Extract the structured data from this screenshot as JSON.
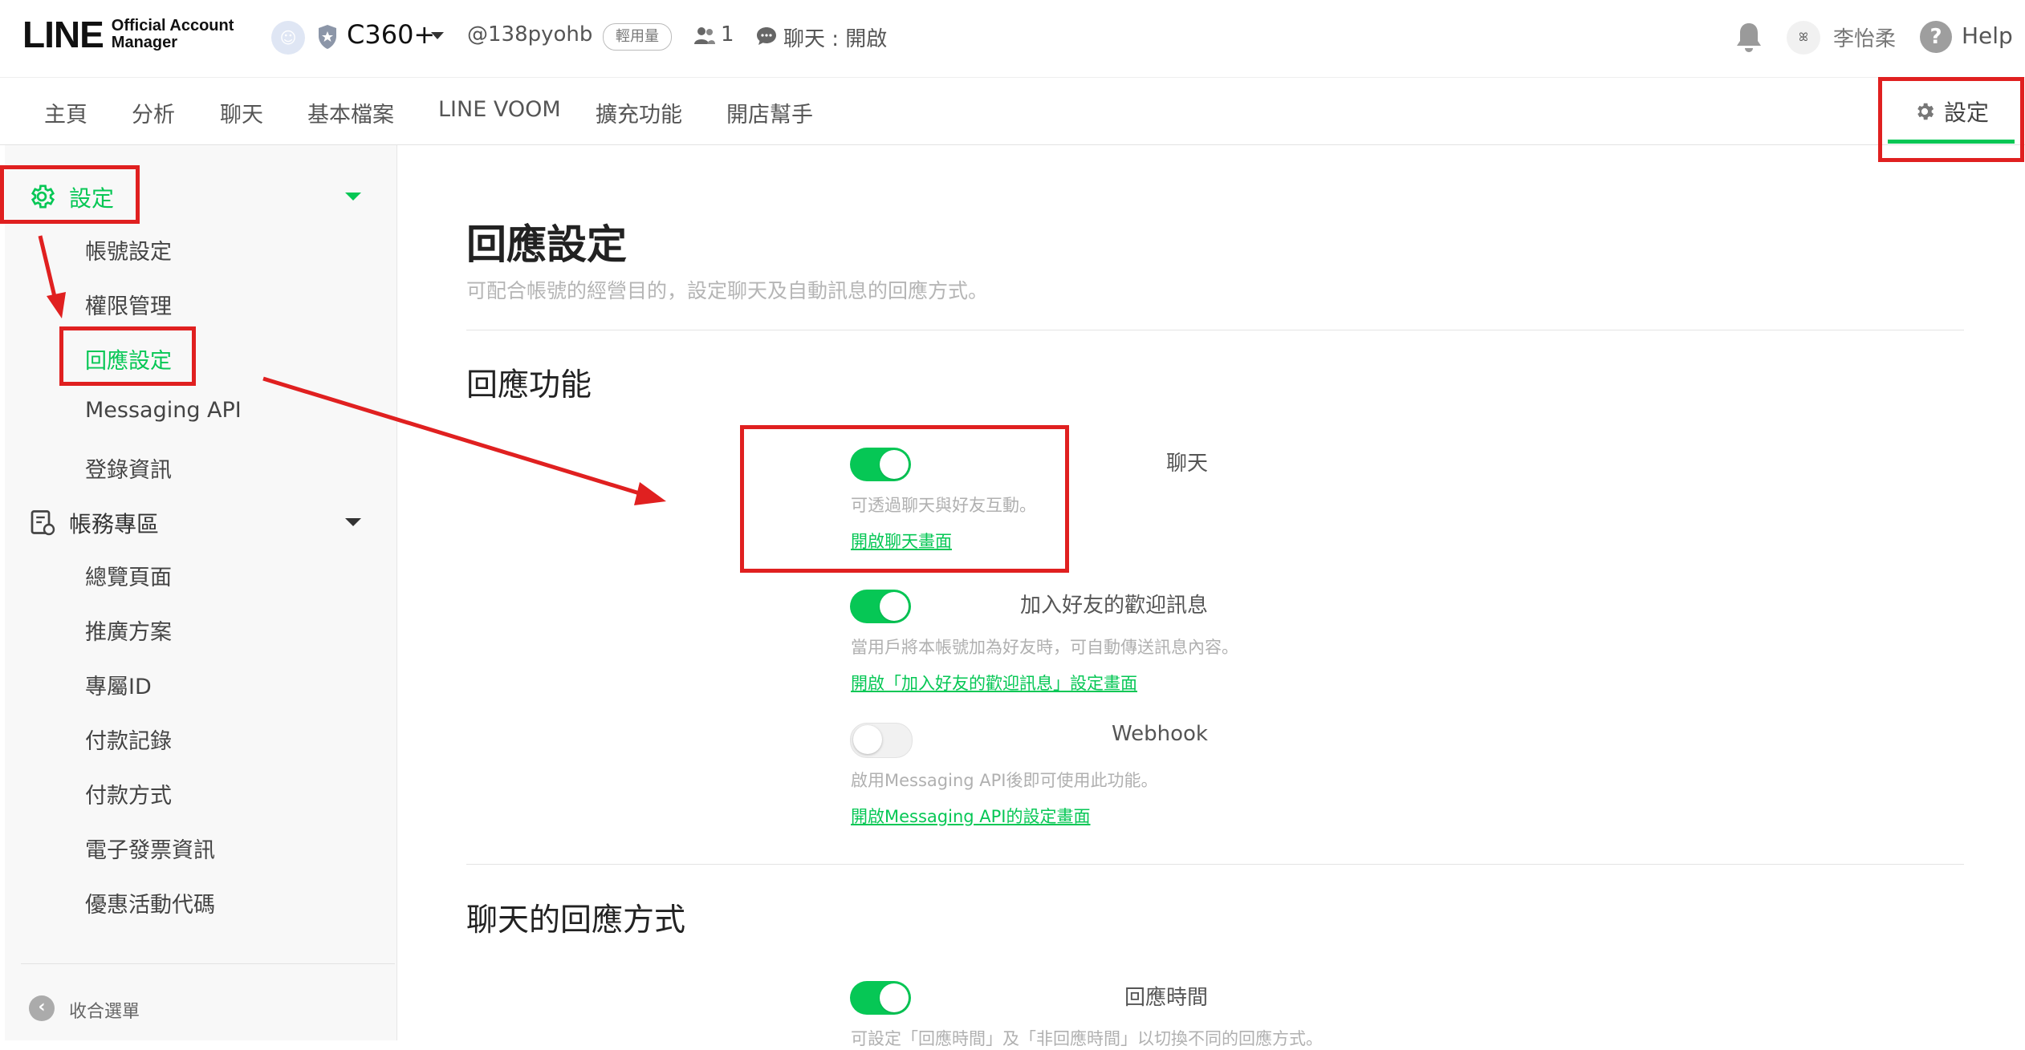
{
  "logo": {
    "brand": "LINE",
    "sub_line1": "Official Account",
    "sub_line2": "Manager"
  },
  "account": {
    "name": "C360+",
    "id": "@138pyohb",
    "plan": "輕用量",
    "friends": "1",
    "chat_status": "聊天 : 開啟"
  },
  "user": {
    "name": "李怡柔",
    "help": "Help"
  },
  "nav": {
    "items": [
      "主頁",
      "分析",
      "聊天",
      "基本檔案",
      "LINE VOOM",
      "擴充功能",
      "開店幫手"
    ],
    "settings": "設定"
  },
  "sidebar": {
    "settings_label": "設定",
    "settings_items": [
      "帳號設定",
      "權限管理",
      "回應設定",
      "Messaging API",
      "登錄資訊"
    ],
    "billing_label": "帳務專區",
    "billing_items": [
      "總覽頁面",
      "推廣方案",
      "專屬ID",
      "付款記錄",
      "付款方式",
      "電子發票資訊",
      "優惠活動代碼"
    ],
    "collapse_label": "收合選單"
  },
  "page": {
    "title": "回應設定",
    "description": "可配合帳號的經營目的，設定聊天及自動訊息的回應方式。",
    "section1": "回應功能",
    "chat": {
      "label": "聊天",
      "enabled": true,
      "desc": "可透過聊天與好友互動。",
      "link": "開啟聊天畫面"
    },
    "welcome": {
      "label": "加入好友的歡迎訊息",
      "enabled": true,
      "desc": "當用戶將本帳號加為好友時，可自動傳送訊息內容。",
      "link": "開啟「加入好友的歡迎訊息」設定畫面"
    },
    "webhook": {
      "label": "Webhook",
      "enabled": false,
      "desc": "啟用Messaging API後即可使用此功能。",
      "link": "開啟Messaging API的設定畫面"
    },
    "section2": "聊天的回應方式",
    "response_time": {
      "label": "回應時間",
      "enabled": true,
      "desc": "可設定「回應時間」及「非回應時間」以切換不同的回應方式。"
    }
  },
  "colors": {
    "accent": "#06c755",
    "annotation": "#e02020"
  }
}
